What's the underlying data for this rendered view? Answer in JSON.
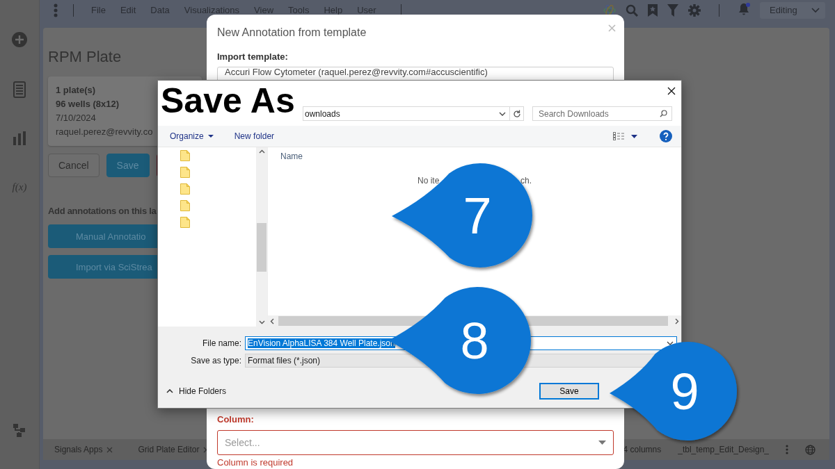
{
  "menu_bar": {
    "items": [
      "File",
      "Edit",
      "Data",
      "Visualizations",
      "View",
      "Tools",
      "Help",
      "User"
    ]
  },
  "notifications": {
    "unread": true
  },
  "mode_select": {
    "value": "Editing"
  },
  "rail": {
    "formula_label": "f(x)"
  },
  "page": {
    "title": "RPM Plate",
    "summary": [
      {
        "text": "1 plate(s)",
        "bold": true
      },
      {
        "text": "96 wells (8x12)",
        "bold": true
      },
      {
        "text": "7/10/2024",
        "bold": false
      },
      {
        "text": "raquel.perez@revvity.co",
        "bold": false
      }
    ],
    "buttons": [
      {
        "label": "Cancel",
        "kind": "secondary"
      },
      {
        "label": "Save",
        "kind": "primary"
      },
      {
        "kind": "danger"
      }
    ],
    "annotations_heading": "Add annotations on this la",
    "annotation_buttons": [
      "Manual Annotatio",
      "Import via SciStrea"
    ]
  },
  "bottom_tabs": [
    {
      "label": "Signals Apps",
      "closable": true
    },
    {
      "label": "Grid Plate Editor",
      "closable": true
    }
  ],
  "bottom_status": [
    "4 columns",
    "_tbl_temp_Edit_Design_"
  ],
  "annotation_dialog": {
    "title": "New Annotation from template",
    "import_label": "Import template:",
    "import_value": "Accuri Flow Cytometer (raquel.perez@revvity.com#accuscientific)",
    "column_label": "Column:",
    "column_placeholder": "Select...",
    "column_error": "Column is required",
    "column_invalid": true
  },
  "save_dialog": {
    "heading": "Save As",
    "address": "ownloads",
    "search_placeholder": "Search Downloads",
    "toolbar": [
      "Organize",
      "New folder"
    ],
    "folders": [
      {
        "kind": "folder"
      },
      {
        "kind": "folder"
      },
      {
        "kind": "folder"
      },
      {
        "kind": "folder"
      },
      {
        "kind": "folder"
      }
    ],
    "column_header": "Name",
    "empty_message_parts": [
      "No ite",
      "ch."
    ],
    "file_name_label": "File name:",
    "file_name": "EnVision AlphaLISA 384 Well Plate.json",
    "file_name_selected": true,
    "type_label": "Save as type:",
    "type_value": "Format files (*.json)",
    "hide_folders": "Hide Folders",
    "save_button": "Save"
  },
  "callouts": [
    "7",
    "8",
    "9"
  ]
}
